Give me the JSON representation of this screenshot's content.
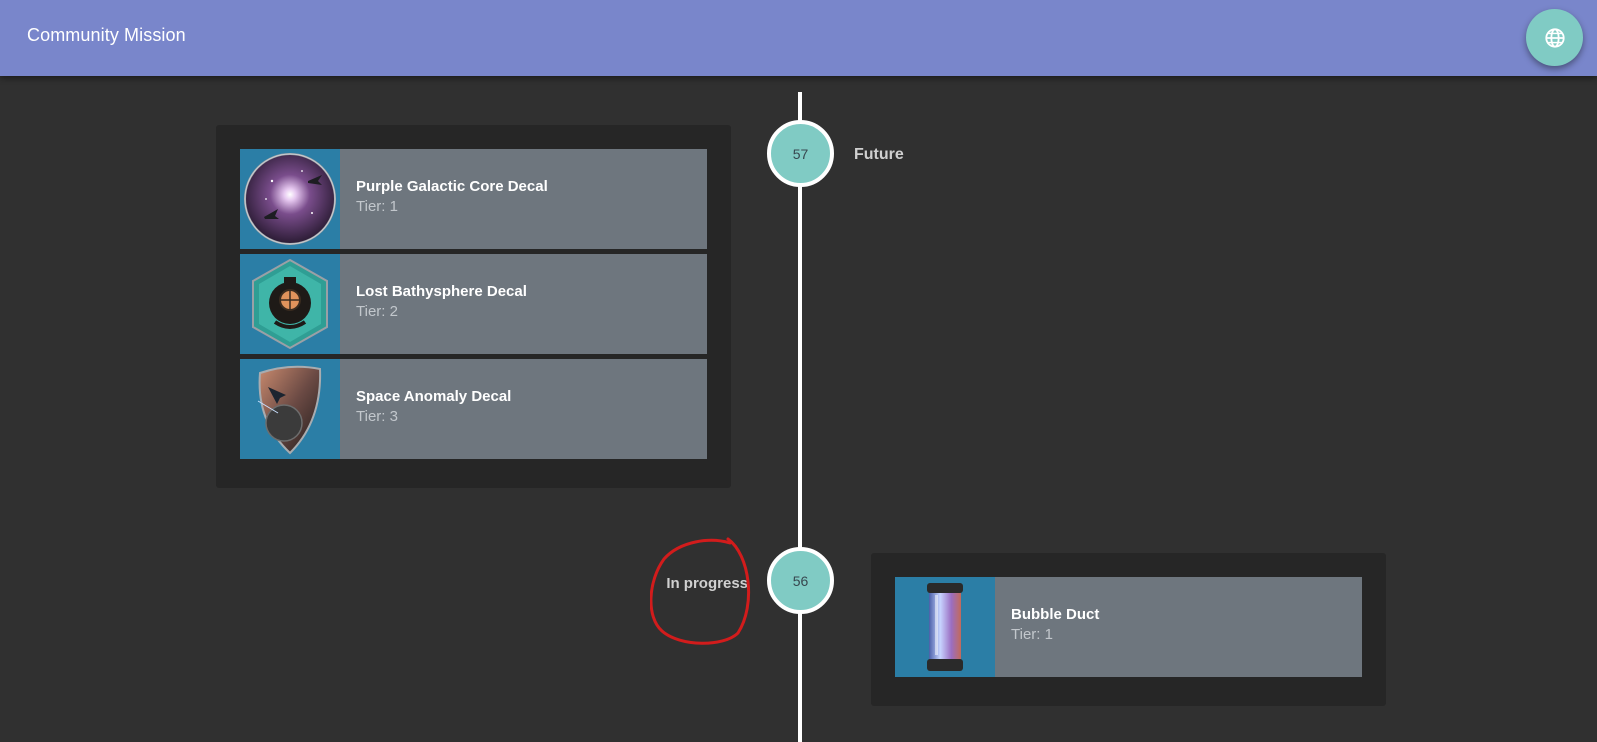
{
  "app_bar": {
    "title": "Community Mission",
    "language_icon": "globe-icon"
  },
  "timeline": [
    {
      "milestone": "57",
      "status": "Future",
      "rewards": [
        {
          "name": "Purple Galactic Core Decal",
          "tier": "Tier: 1",
          "icon": "galaxy-decal-icon"
        },
        {
          "name": "Lost Bathysphere Decal",
          "tier": "Tier: 2",
          "icon": "bathysphere-decal-icon"
        },
        {
          "name": "Space Anomaly Decal",
          "tier": "Tier: 3",
          "icon": "anomaly-decal-icon"
        }
      ]
    },
    {
      "milestone": "56",
      "status": "In progress",
      "rewards": [
        {
          "name": "Bubble Duct",
          "tier": "Tier: 1",
          "icon": "bubble-duct-icon"
        }
      ]
    }
  ],
  "colors": {
    "app_bar": "#7986cb",
    "accent": "#80cbc4",
    "background": "#303030",
    "card": "#262626",
    "reward_row": "#6e767e",
    "thumb_bg": "#2b7ea6",
    "annotation": "#d21c1c"
  }
}
